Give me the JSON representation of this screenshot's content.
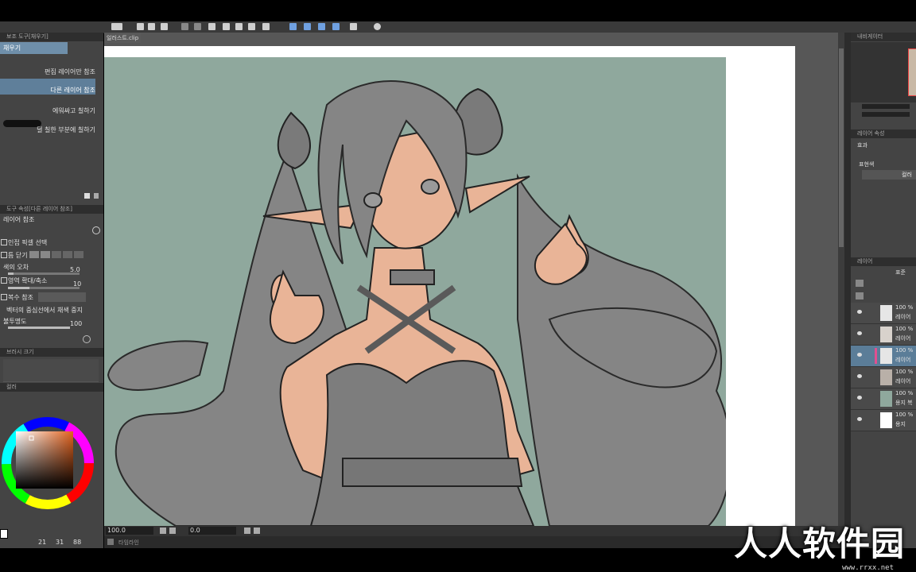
{
  "left_panel": {
    "sub_tool_title": "보조 도구[채우기]",
    "selected_tool": "채우기",
    "options": [
      {
        "label": "편집 레이어만 참조",
        "selected": false
      },
      {
        "label": "다른 레이어 참조",
        "selected": true
      },
      {
        "label": "에워싸고 칠하기",
        "selected": false
      },
      {
        "label": "덜 칠한 부분에 칠하기",
        "selected": false
      }
    ],
    "tool_property_title": "도구 속성[다른 레이어 참조]",
    "tool_property_name": "레이어 참조",
    "properties": {
      "adjacent": "인접 픽셀 선택",
      "close_gap": "틈 닫기",
      "color_margin": "색의 오차",
      "color_margin_value": "5.0",
      "area_scaling": "영역 확대/축소",
      "area_scaling_value": "10",
      "multi_ref": "복수 참조",
      "vector_stop": "벡터의 중심선에서 채색 중지",
      "opacity": "불투명도",
      "opacity_value": "100"
    },
    "brush_size_title": "브러시 크기",
    "color_title": "컬러",
    "color_values": [
      "21",
      "31",
      "88"
    ]
  },
  "canvas": {
    "doc_tab": "일러스트.clip",
    "zoom": "100.0",
    "angle": "0.0",
    "timeline_label": "타임라인"
  },
  "right_panel": {
    "navigator_title": "내비게이터",
    "layer_prop_title": "레이어 속성",
    "effect_label": "효과",
    "expression_label": "표현색",
    "expression_value": "컬러",
    "layer_title": "레이어",
    "blend_mode": "표준",
    "layers": [
      {
        "opacity": "100 %",
        "name": "레이어",
        "selected": false,
        "thumb": "#e6e6e6"
      },
      {
        "opacity": "100 %",
        "name": "레이어",
        "selected": false,
        "thumb": "#d8d2cc"
      },
      {
        "opacity": "100 %",
        "name": "레이어",
        "selected": true,
        "thumb": "#e6e6e6"
      },
      {
        "opacity": "100 %",
        "name": "레이어",
        "selected": false,
        "thumb": "#b9b0a8"
      },
      {
        "opacity": "100 %",
        "name": "용지 복",
        "selected": false,
        "thumb": "#8fa89d"
      },
      {
        "opacity": "100 %",
        "name": "용지",
        "selected": false,
        "thumb": "#ffffff"
      }
    ]
  },
  "watermark": {
    "text": "人人软件园",
    "sub": "www.rrxx.net"
  },
  "colors": {
    "canvas_bg": "#8fa89d",
    "skin": "#e9b497",
    "dress": "#7d7d7d",
    "highlight": "#6f8faa"
  }
}
